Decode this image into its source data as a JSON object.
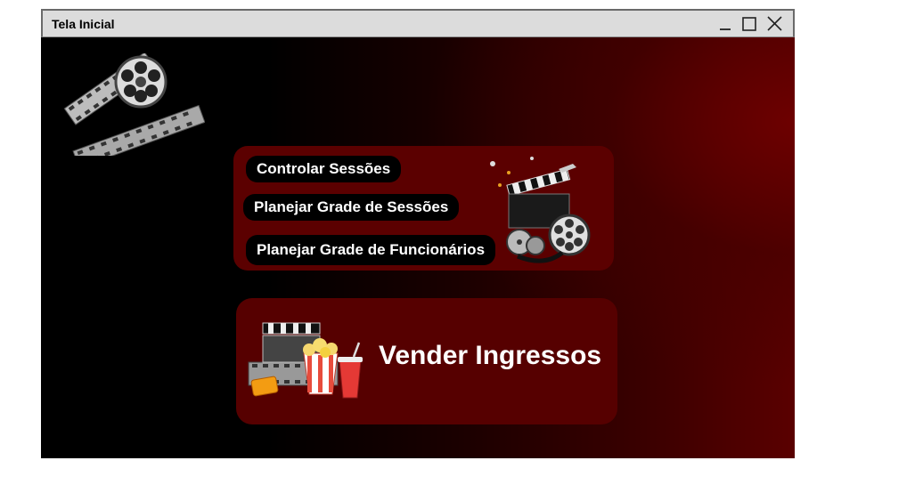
{
  "window": {
    "title": "Tela Inicial",
    "controls": [
      "minimize-icon",
      "maximize-icon",
      "close-icon"
    ]
  },
  "menu": {
    "buttons": [
      {
        "label": "Controlar Sessões"
      },
      {
        "label": "Planejar Grade de Sessões"
      },
      {
        "label": "Planejar Grade de Funcionários"
      }
    ],
    "icon": "film-clapper-reel-icon"
  },
  "sell": {
    "label": "Vender Ingressos",
    "icon": "clapper-popcorn-soda-icon"
  },
  "logo": {
    "icon": "film-reel-logo-icon"
  },
  "colors": {
    "panel": "#5b0000",
    "pill": "#000000",
    "text": "#ffffff",
    "titlebar": "#dcdcdc"
  }
}
